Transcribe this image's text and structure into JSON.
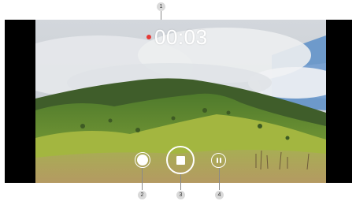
{
  "recorder": {
    "timer": "00:03",
    "recording_indicator_color": "#e53935",
    "controls": {
      "capture_icon": "capture-photo-icon",
      "stop_icon": "stop-icon",
      "pause_icon": "pause-icon"
    }
  },
  "callouts": [
    "1",
    "2",
    "3",
    "4"
  ]
}
